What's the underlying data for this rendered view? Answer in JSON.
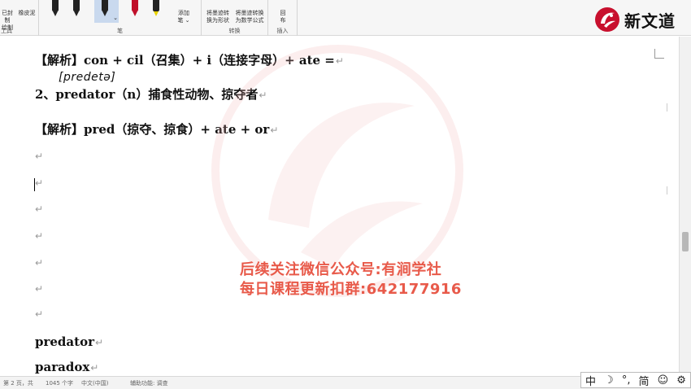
{
  "ribbon": {
    "tools_left": [
      "已封制",
      "绘制",
      "橡皮泥"
    ],
    "tools_left_group": "工具",
    "pen_group": "笔",
    "add_pen": [
      "添加",
      "笔 ⌄"
    ],
    "convert_shape": [
      "将墨迹转",
      "换为形状"
    ],
    "convert_math": [
      "将墨迹转换",
      "为数学公式"
    ],
    "convert_group": "转换",
    "insert_tool": [
      "回",
      "布"
    ],
    "insert_group": "插入"
  },
  "brand": {
    "name": "新文道",
    "accent": "#c8102e"
  },
  "document": {
    "line1": "【解析】con + cil（召集）+ i（连接字母）+ ate =",
    "handwriting": "[predetə]",
    "line2": "2、predator（n）捕食性动物、掠夺者",
    "line3": "【解析】pred（掠夺、掠食）+ ate + or",
    "para_mark": "↵",
    "word1": "predator",
    "word2": "paradox"
  },
  "watermark": {
    "line1": "后续关注微信公众号:有涧学社",
    "line2": "每日课程更新扣群:642177916",
    "color": "#e85a4a"
  },
  "statusbar": {
    "items": [
      "第 2 页，共",
      "1045 个字",
      "中文(中国)",
      "辅助功能: 调查"
    ]
  },
  "ime": {
    "lang": "中",
    "moon": "☽",
    "punct": "°,",
    "mode": "简",
    "emoji": "☺",
    "settings": "⚙"
  }
}
